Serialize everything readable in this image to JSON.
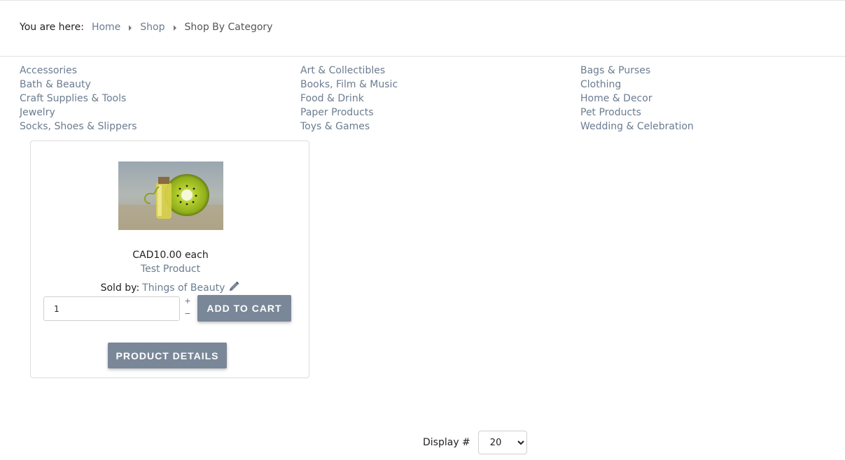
{
  "breadcrumb": {
    "label": "You are here:",
    "items": [
      "Home",
      "Shop"
    ],
    "current": "Shop By Category"
  },
  "categories": {
    "col1": [
      "Accessories",
      "Bath & Beauty",
      "Craft Supplies & Tools",
      "Jewelry",
      "Socks, Shoes & Slippers"
    ],
    "col2": [
      "Art & Collectibles",
      "Books, Film & Music",
      "Food & Drink",
      "Paper Products",
      "Toys & Games"
    ],
    "col3": [
      "Bags & Purses",
      "Clothing",
      "Home & Decor",
      "Pet Products",
      "Wedding & Celebration"
    ]
  },
  "product": {
    "price": "CAD10.00 each",
    "name": "Test Product",
    "sold_by_label": "Sold by:",
    "seller": "Things of Beauty",
    "quantity": "1",
    "increment": "+",
    "decrement": "−",
    "add_to_cart": "ADD TO CART",
    "details": "PRODUCT DETAILS"
  },
  "display": {
    "label": "Display #",
    "selected": "20"
  },
  "colors": {
    "link": "#6b7c90",
    "button": "#7a8798"
  }
}
